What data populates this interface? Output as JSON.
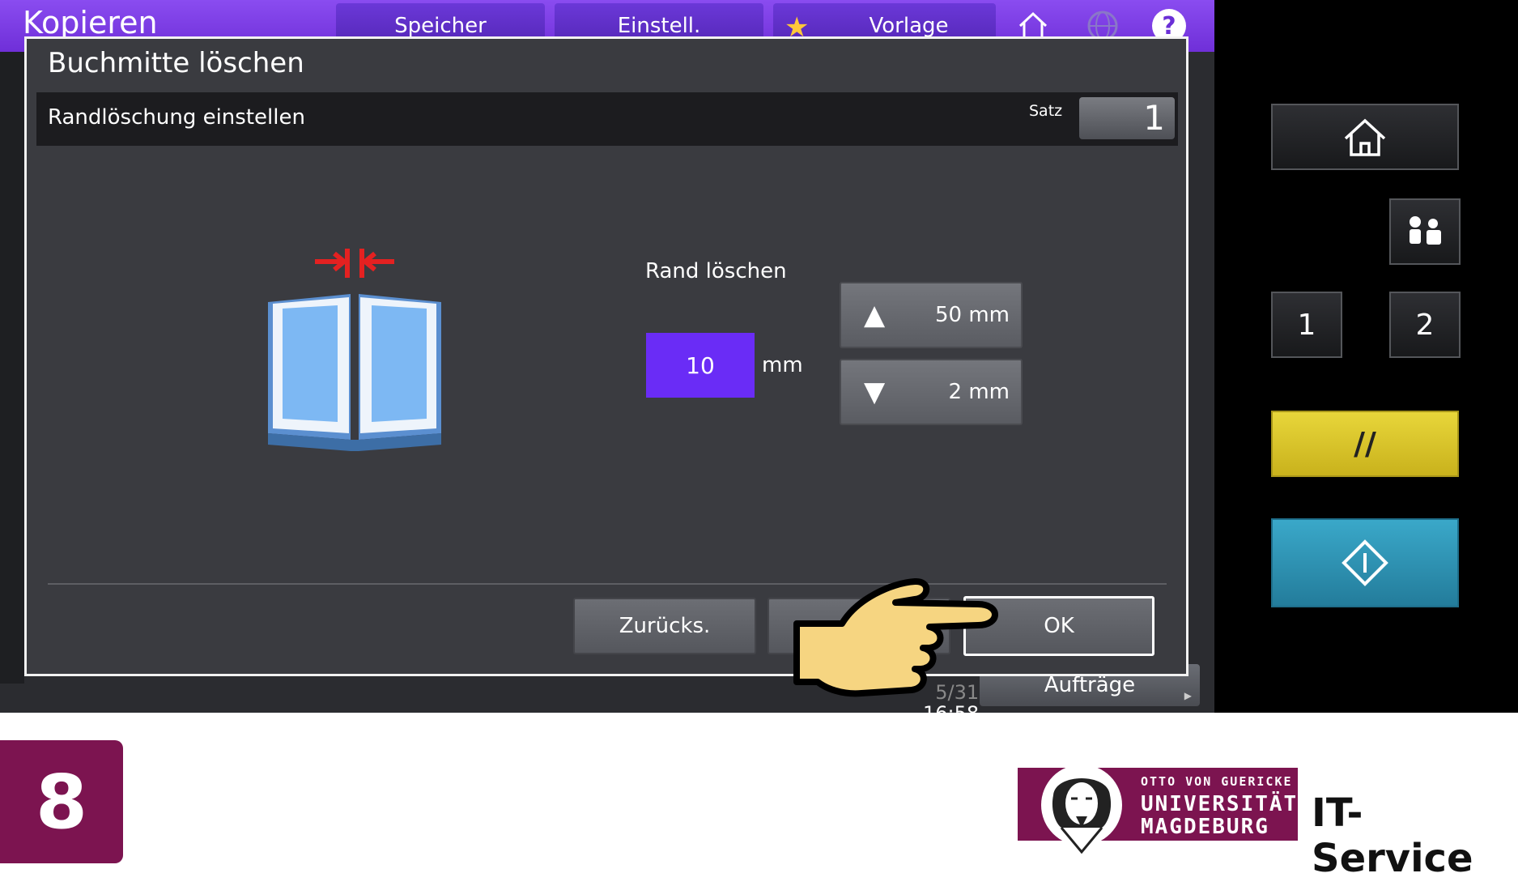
{
  "header": {
    "app_title": "Kopieren",
    "tabs": [
      {
        "label": "Speicher"
      },
      {
        "label": "Einstell."
      },
      {
        "label": "Vorlage"
      }
    ]
  },
  "dialog": {
    "title": "Buchmitte löschen",
    "subtitle": "Randlöschung einstellen",
    "satz_label": "Satz",
    "satz_value": "1",
    "rand_label": "Rand löschen",
    "value": "10",
    "unit": "mm",
    "max_label": "50 mm",
    "min_label": "2 mm",
    "buttons": {
      "back": "Zurücks.",
      "mid": "",
      "ok": "OK"
    }
  },
  "status": {
    "date_partial": "5/31",
    "time": "16:58",
    "jobs_label": "Aufträge"
  },
  "hardware_panel": {
    "one_label": "1",
    "two_label": "2",
    "reset_label": "//"
  },
  "footer": {
    "step_number": "8",
    "logo_line1": "OTTO VON GUERICKE",
    "logo_line2": "UNIVERSITÄT",
    "logo_line3": "MAGDEBURG",
    "service_label": "IT-Service"
  },
  "colors": {
    "accent_purple": "#6a2cf6",
    "brand_maroon": "#7c1450",
    "reset_yellow": "#e8d63a",
    "start_blue": "#3aa8c9"
  },
  "icons": [
    "home-icon",
    "globe-icon",
    "help-icon",
    "star-icon",
    "arrow-up-icon",
    "arrow-down-icon",
    "user-icon",
    "start-icon",
    "hand-pointer-icon",
    "book-center-erase-icon"
  ]
}
